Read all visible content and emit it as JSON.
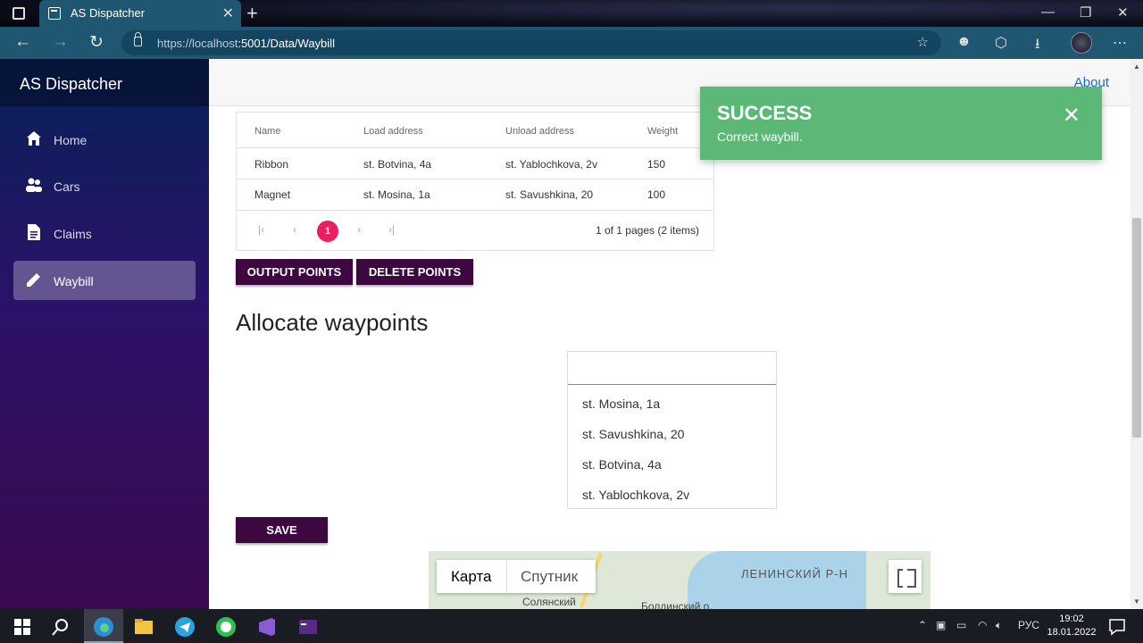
{
  "browser": {
    "tab_title": "AS Dispatcher",
    "url_host": "https://localhost",
    "url_path": ":5001/Data/Waybill"
  },
  "sidebar": {
    "brand": "AS Dispatcher",
    "items": [
      {
        "label": "Home",
        "icon": "home-icon"
      },
      {
        "label": "Cars",
        "icon": "people-icon"
      },
      {
        "label": "Claims",
        "icon": "document-icon"
      },
      {
        "label": "Waybill",
        "icon": "pencil-icon",
        "active": true
      }
    ]
  },
  "topbar": {
    "about": "About"
  },
  "grid": {
    "columns": [
      "Name",
      "Load address",
      "Unload address",
      "Weight"
    ],
    "rows": [
      [
        "Ribbon",
        "st. Botvina, 4a",
        "st. Yablochkova, 2v",
        "150"
      ],
      [
        "Magnet",
        "st. Mosina, 1a",
        "st. Savushkina, 20",
        "100"
      ]
    ],
    "current_page": "1",
    "pager_info": "1 of 1 pages (2 items)"
  },
  "buttons": {
    "output": "OUTPUT POINTS",
    "delete": "DELETE POINTS",
    "save": "SAVE"
  },
  "section_title": "Allocate waypoints",
  "waypoints": [
    "st. Mosina, 1a",
    "st. Savushkina, 20",
    "st. Botvina, 4a",
    "st. Yablochkova, 2v"
  ],
  "map": {
    "type_map": "Карта",
    "type_satellite": "Спутник",
    "label_district": "ЛЕНИНСКИЙ Р-Н",
    "label_1": "Солянский",
    "label_2": "Болдинский о."
  },
  "toast": {
    "title": "SUCCESS",
    "message": "Correct waybill.",
    "color": "#5cb877"
  },
  "taskbar": {
    "lang": "РУС",
    "time": "19:02",
    "date": "18.01.2022"
  }
}
